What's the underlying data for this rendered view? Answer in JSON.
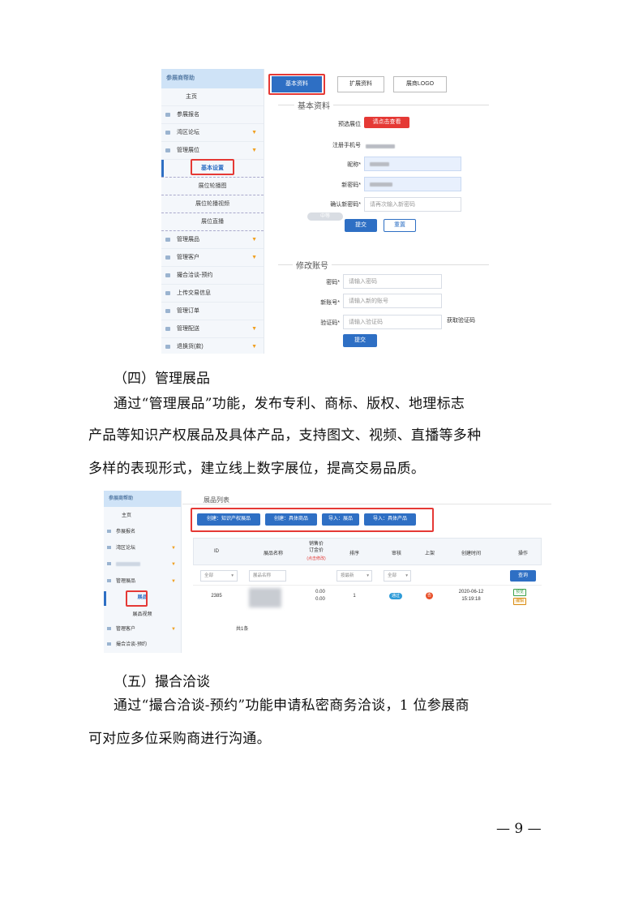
{
  "screenshot1": {
    "sidebar": {
      "header": "参展商帮助",
      "items": [
        {
          "label": "主页",
          "icon": "none",
          "arrow": false
        },
        {
          "label": "参展报名",
          "icon": "doc-icon",
          "arrow": false
        },
        {
          "label": "湾区论坛",
          "icon": "list-icon",
          "arrow": true
        },
        {
          "label": "管理展位",
          "icon": "grid-icon",
          "arrow": true
        }
      ],
      "sub_items": [
        "基本设置",
        "展位轮播图",
        "展位轮播视频",
        "展位直播"
      ],
      "items_after": [
        {
          "label": "管理展品",
          "arrow": true
        },
        {
          "label": "管理客户",
          "arrow": true
        },
        {
          "label": "撮合洽谈-预约",
          "arrow": false
        },
        {
          "label": "上传交易信息",
          "arrow": false
        },
        {
          "label": "管理订单",
          "arrow": false
        },
        {
          "label": "管理配送",
          "arrow": true
        },
        {
          "label": "退换货(款)",
          "arrow": true
        }
      ],
      "arrow_glyph": "▼"
    },
    "tabs": [
      "基本资料",
      "扩展资料",
      "展商LOGO"
    ],
    "basic": {
      "section_title": "基本资料",
      "booth_label": "预选展位",
      "booth_button": "请点击查看",
      "phone_label": "注册手机号",
      "nickname_label": "昵称*",
      "newpwd_label": "新密码*",
      "confirm_label": "确认新密码*",
      "confirm_placeholder": "请再次输入新密码",
      "strength_badge": "中等",
      "submit": "提交",
      "reset": "重置"
    },
    "account": {
      "section_title": "修改账号",
      "pwd_label": "密码*",
      "pwd_placeholder": "请输入密码",
      "newacct_label": "新账号*",
      "newacct_placeholder": "请输入新的账号",
      "code_label": "验证码*",
      "code_placeholder": "请输入验证码",
      "get_code": "获取验证码",
      "submit": "提交"
    }
  },
  "text": {
    "heading4": "（四）管理展品",
    "para4": [
      "通过“管理展品”功能，发布专利、商标、版权、地理标志",
      "产品等知识产权展品及具体产品，支持图文、视频、直播等多种",
      "多样的表现形式，建立线上数字展位，提高交易品质。"
    ],
    "heading5": "（五）撮合洽谈",
    "para5": [
      "通过“撮合洽谈-预约”功能申请私密商务洽谈，1 位参展商",
      "可对应多位采购商进行沟通。"
    ],
    "page_number": "— 9 —"
  },
  "screenshot2": {
    "sidebar": {
      "header": "参展商帮助",
      "items": [
        "主页",
        "参展报名",
        "湾区论坛",
        "",
        "管理展品"
      ],
      "sub_active": "展品",
      "sub_other": "展品视频",
      "after": [
        "管理客户",
        "撮合洽谈-预约"
      ]
    },
    "title": "展品列表",
    "buttons": [
      "创建：知识产权展品",
      "创建：具体商品",
      "导入：展品",
      "导入：具体产品"
    ],
    "table": {
      "headers": [
        "ID",
        "展品名称",
        "销售价\n订金价",
        "排序",
        "审核",
        "上架",
        "创建时间",
        "操作"
      ],
      "price_note": "(点击修改)",
      "filter_all": "全部",
      "filter_name": "展品名称",
      "filter_sort": "按最新",
      "filter_audit": "全部",
      "query": "查询",
      "row": {
        "id": "2385",
        "price1": "0.00",
        "price2": "0.00",
        "sort": "1",
        "audit": "通过",
        "shelf": "否",
        "date": "2020-06-12",
        "time": "15:19:18",
        "op1": "预览",
        "op2": "编辑"
      },
      "total": "共1条"
    }
  }
}
